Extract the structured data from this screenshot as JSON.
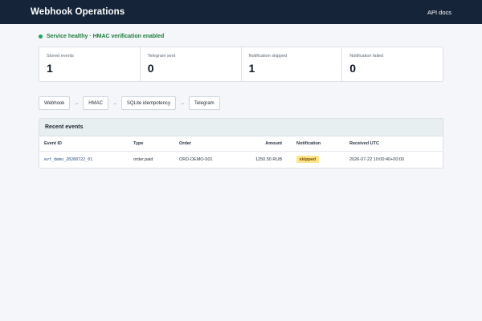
{
  "header": {
    "title": "Webhook Operations",
    "api_docs_label": "API docs"
  },
  "status": {
    "text": "Service healthy · HMAC verification enabled",
    "color": "#22a55a"
  },
  "stats": [
    {
      "label": "Stored events",
      "value": "1"
    },
    {
      "label": "Telegram sent",
      "value": "0"
    },
    {
      "label": "Notification skipped",
      "value": "1"
    },
    {
      "label": "Notification failed",
      "value": "0"
    }
  ],
  "pipeline": {
    "steps": [
      "Webhook",
      "HMAC",
      "SQLite idempotency",
      "Telegram"
    ],
    "arrow": "→"
  },
  "events": {
    "title": "Recent events",
    "columns": [
      "Event ID",
      "Type",
      "Order",
      "Amount",
      "Notification",
      "Received UTC"
    ],
    "rows": [
      {
        "event_id": "evt_demo_20260722_01",
        "type": "order.paid",
        "order": "ORD-DEMO-501",
        "amount": "1250.50 RUB",
        "notification": "skipped",
        "received": "2026-07-22 10:00:40+00:00"
      }
    ]
  },
  "colors": {
    "topbar": "#16243a",
    "badge_skipped_bg": "#fde68a",
    "badge_skipped_text": "#7a4b00"
  }
}
